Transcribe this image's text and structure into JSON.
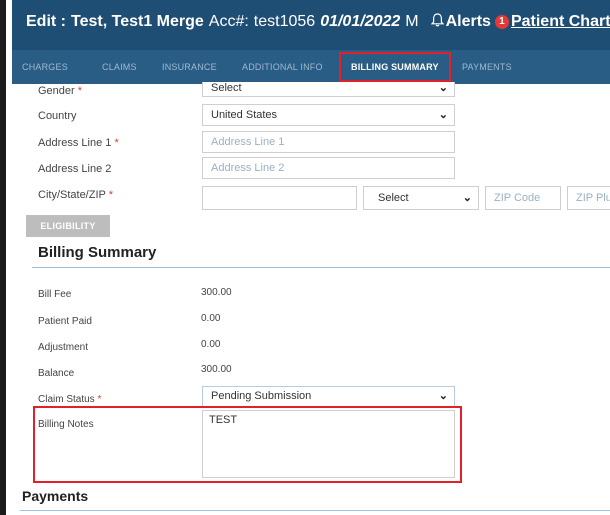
{
  "header": {
    "edit_prefix": "Edit :",
    "patient_name": "Test, Test1 Merge",
    "acc_label": "Acc#:",
    "acc_value": "test1056",
    "date": "01/01/2022",
    "sex": "M",
    "alerts_label": "Alerts",
    "alerts_count": "1",
    "patient_chart_label": "Patient Chart"
  },
  "tabs": [
    {
      "label": "CHARGES"
    },
    {
      "label": "CLAIMS"
    },
    {
      "label": "INSURANCE"
    },
    {
      "label": "ADDITIONAL INFO"
    },
    {
      "label": "BILLING SUMMARY",
      "active": true
    },
    {
      "label": "PAYMENTS"
    }
  ],
  "form": {
    "gender": {
      "label": "Gender",
      "required": "*",
      "value": "Select"
    },
    "country": {
      "label": "Country",
      "value": "United States"
    },
    "address1": {
      "label": "Address Line 1",
      "required": "*",
      "placeholder": "Address Line 1"
    },
    "address2": {
      "label": "Address Line 2",
      "placeholder": "Address Line 2"
    },
    "city_state_zip": {
      "label": "City/State/ZIP",
      "required": "*",
      "city_value": "",
      "state_value": "Select",
      "zip_placeholder": "ZIP Code",
      "zip_plus_placeholder": "ZIP Plus"
    }
  },
  "eligibility_button": "ELIGIBILITY",
  "billing_summary": {
    "title": "Billing Summary",
    "bill_fee": {
      "label": "Bill Fee",
      "value": "300.00"
    },
    "patient_paid": {
      "label": "Patient Paid",
      "value": "0.00"
    },
    "adjustment": {
      "label": "Adjustment",
      "value": "0.00"
    },
    "balance": {
      "label": "Balance",
      "value": "300.00"
    },
    "claim_status": {
      "label": "Claim Status",
      "required": "*",
      "value": "Pending Submission"
    },
    "billing_notes": {
      "label": "Billing Notes",
      "value": "TEST"
    }
  },
  "payments": {
    "title": "Payments"
  },
  "colors": {
    "header_bg": "#1f4e75",
    "tabs_bg": "#2a5d86",
    "highlight": "#e2202a",
    "required": "#e53935"
  }
}
